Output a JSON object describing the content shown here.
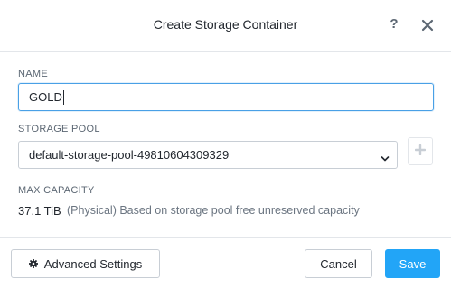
{
  "dialog": {
    "title": "Create Storage Container",
    "help_label": "?",
    "close_icon": "close-icon"
  },
  "form": {
    "name": {
      "label": "NAME",
      "value": "GOLD"
    },
    "storage_pool": {
      "label": "STORAGE POOL",
      "selected": "default-storage-pool-49810604309329",
      "add_icon": "plus-icon"
    },
    "max_capacity": {
      "label": "MAX CAPACITY",
      "value": "37.1 TiB",
      "description": "(Physical) Based on storage pool free unreserved capacity"
    }
  },
  "footer": {
    "advanced_label": "Advanced Settings",
    "advanced_icon": "gear-icon",
    "cancel_label": "Cancel",
    "save_label": "Save"
  },
  "colors": {
    "primary": "#22a5f7",
    "focus_border": "#49a0e6",
    "text": "#22272e",
    "muted": "#5c6773"
  }
}
